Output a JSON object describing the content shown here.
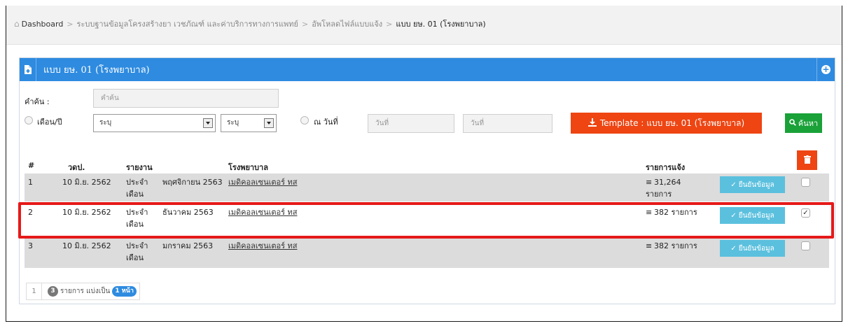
{
  "breadcrumb": {
    "dashboard": "Dashboard",
    "level1": "ระบบฐานข้อมูลโครงสร้างยา เวชภัณฑ์ และค่าบริการทางการแพทย์",
    "level2": "อัพโหลดไฟล์แบบแจ้ง",
    "current": "แบบ ยษ. 01 (โรงพยาบาล)"
  },
  "panel": {
    "title": "แบบ ยษ. 01 (โรงพยาบาล)"
  },
  "search": {
    "label": "คำค้น :",
    "placeholder": "คำค้น",
    "month_year_label": "เดือน/ปี",
    "month_select": "ระบุ",
    "year_select": "ระบุ",
    "date_label": "ณ วันที่",
    "date_from_placeholder": "วันที่",
    "date_to_placeholder": "วันที่",
    "template_button": "Template : แบบ ยษ. 01 (โรงพยาบาล)",
    "search_button": "ค้นหา"
  },
  "table": {
    "headers": {
      "num": "#",
      "date": "วดป.",
      "report": "รายงาน",
      "hospital": "โรงพยาบาล",
      "items": "รายการแจ้ง"
    },
    "confirm_label": "ยืนยันข้อมูล",
    "rows": [
      {
        "num": "1",
        "date": "10 มิ.ย. 2562",
        "report_line1": "ประจำ",
        "report_line2": "เดือน",
        "period": "พฤศจิกายน 2563",
        "hospital": "เมดิคอลเซนเตอร์ ทส",
        "items_line1": "31,264",
        "items_line2": "รายการ",
        "checked": false
      },
      {
        "num": "2",
        "date": "10 มิ.ย. 2562",
        "report_line1": "ประจำ",
        "report_line2": "เดือน",
        "period": "ธันวาคม 2563",
        "hospital": "เมดิคอลเซนเตอร์ ทส",
        "items_line1": "382 รายการ",
        "items_line2": "",
        "checked": true
      },
      {
        "num": "3",
        "date": "10 มิ.ย. 2562",
        "report_line1": "ประจำ",
        "report_line2": "เดือน",
        "period": "มกราคม 2563",
        "hospital": "เมดิคอลเซนเตอร์ ทส",
        "items_line1": "382 รายการ",
        "items_line2": "",
        "checked": false
      }
    ]
  },
  "pager": {
    "page": "1",
    "count": "3",
    "text1": "รายการ แบ่งเป็น",
    "pages": "1 หน้า"
  },
  "colors": {
    "header_blue": "#2e8be0",
    "danger": "#ee4512",
    "success": "#1aa138",
    "info": "#5bc0de",
    "highlight": "#e61919"
  }
}
